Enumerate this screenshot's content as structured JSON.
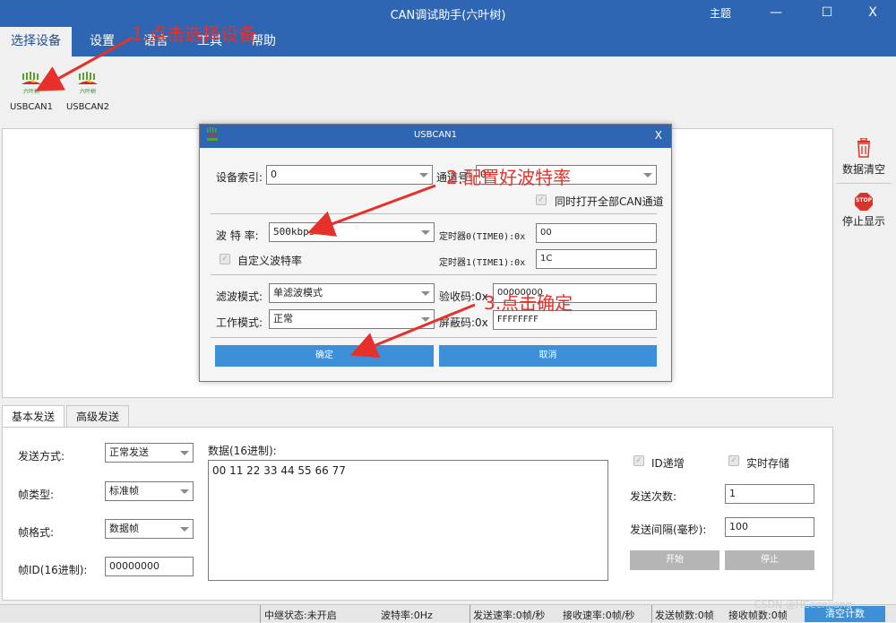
{
  "window": {
    "title": "CAN调试助手(六叶树)",
    "theme_label": "主题",
    "minimize": "—",
    "maximize": "☐",
    "close": "X"
  },
  "menu": [
    {
      "label": "选择设备"
    },
    {
      "label": "设置"
    },
    {
      "label": "语言"
    },
    {
      "label": "工具"
    },
    {
      "label": "帮助"
    }
  ],
  "devices": [
    {
      "label": "USBCAN1",
      "logo_text": "六叶树"
    },
    {
      "label": "USBCAN2",
      "logo_text": "六叶树"
    }
  ],
  "side_panel": {
    "clear_label": "数据清空",
    "stop_label": "停止显示",
    "stop_icon_text": "STOP"
  },
  "dialog": {
    "title": "USBCAN1",
    "close": "X",
    "device_index_label": "设备索引:",
    "device_index_value": "0",
    "channel_label": "通道号:",
    "channel_value": "0",
    "open_all_label": "同时打开全部CAN通道",
    "baud_label": "波 特 率:",
    "baud_value": "500kbps",
    "timer0_label": "定时器0(TIME0):0x",
    "timer0_value": "00",
    "timer1_label": "定时器1(TIME1):0x",
    "timer1_value": "1C",
    "custom_baud_label": "自定义波特率",
    "filter_label": "滤波模式:",
    "filter_value": "单滤波模式",
    "accept_code_label": "验收码:0x",
    "accept_code_value": "00000000",
    "work_mode_label": "工作模式:",
    "work_mode_value": "正常",
    "mask_label": "屏蔽码:0x",
    "mask_value": "FFFFFFFF",
    "ok_label": "确定",
    "cancel_label": "取消"
  },
  "tabs": [
    {
      "label": "基本发送"
    },
    {
      "label": "高级发送"
    }
  ],
  "send": {
    "mode_label": "发送方式:",
    "mode_value": "正常发送",
    "frame_type_label": "帧类型:",
    "frame_type_value": "标准帧",
    "frame_format_label": "帧格式:",
    "frame_format_value": "数据帧",
    "frame_id_label": "帧ID(16进制):",
    "frame_id_value": "00000000",
    "data_label": "数据(16进制):",
    "data_value": "00 11 22 33 44 55 66 77",
    "id_increment_label": "ID递增",
    "realtime_save_label": "实时存储",
    "send_count_label": "发送次数:",
    "send_count_value": "1",
    "send_interval_label": "发送间隔(毫秒):",
    "send_interval_value": "100",
    "start_label": "开始",
    "stop_label": "停止"
  },
  "status": {
    "relay": "中继状态:未开启",
    "baud": "波特率:0Hz",
    "send_rate": "发送速率:0帧/秒",
    "recv_rate": "接收速率:0帧/秒",
    "sent_frames": "发送帧数:0帧",
    "recv_frames": "接收帧数:0帧",
    "clear_count": "清空计数"
  },
  "annotations": {
    "step1": "1.点击选择设备",
    "step2": "2.配置好波特率",
    "step3": "3.点击确定",
    "color": "#e8302a"
  },
  "watermark": "CSDN @HCeenjiang",
  "colors": {
    "titlebar": "#2f66b3",
    "button_blue": "#3d8fd8",
    "button_gray": "#b5b5b5"
  }
}
